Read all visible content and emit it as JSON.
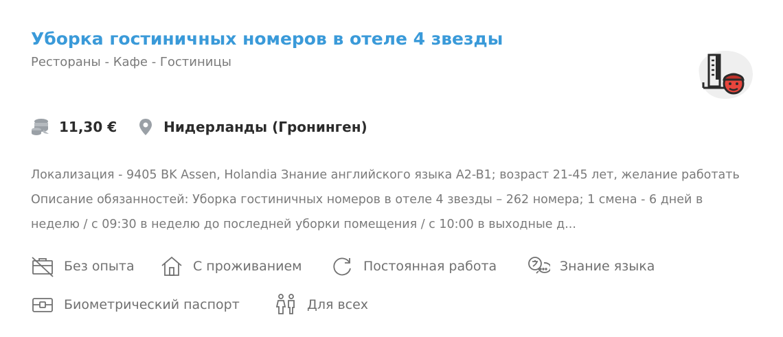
{
  "job": {
    "title": "Уборка гостиничных номеров в отеле 4 звезды",
    "category": "Рестораны - Кафе - Гостиницы",
    "category_icon": "hotel-worker-icon",
    "salary": "11,30 €",
    "location": "Нидерланды (Гронинген)",
    "description": "Локализация - 9405 BK Assen, Holandia Знание английского языка A2-B1; возраст 21-45 лет, желание работать Описание обязанностей: Уборка гостиничных номеров в отеле 4 звезды – 262 номера; 1 смена - 6 дней в неделю / с 09:30 в неделю до последней уборки помещения / с 10:00 в выходные д...",
    "features": [
      {
        "label": "Без опыта",
        "icon": "no-experience-icon"
      },
      {
        "label": "С проживанием",
        "icon": "house-icon"
      },
      {
        "label": "Постоянная работа",
        "icon": "refresh-icon"
      },
      {
        "label": "Знание языка",
        "icon": "language-icon"
      },
      {
        "label": "Биометрический паспорт",
        "icon": "passport-icon"
      },
      {
        "label": "Для всех",
        "icon": "people-icon"
      }
    ]
  },
  "colors": {
    "title": "#3a9ad9",
    "text_muted": "#7a7a7a",
    "text_dark": "#2b2b2b",
    "icon_gray": "#9aa0a6",
    "badge_bg": "#efefef",
    "accent_red": "#e8453c"
  }
}
